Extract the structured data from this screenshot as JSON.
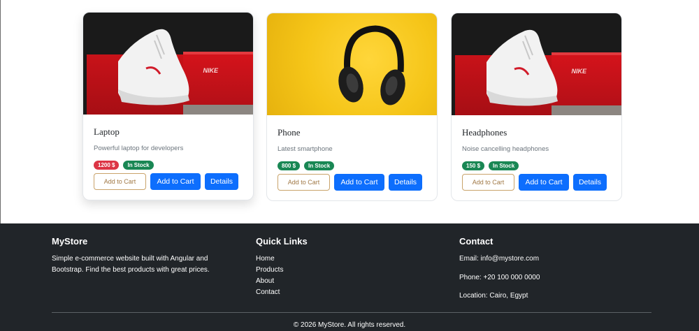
{
  "products": [
    {
      "title": "Laptop",
      "description": "Powerful laptop for developers",
      "price": "1200 $",
      "stock": "In Stock",
      "image_icon": "sneaker-image",
      "add_label": "Add to Cart",
      "cart_label": "Add to Cart",
      "details_label": "Details"
    },
    {
      "title": "Phone",
      "description": "Latest smartphone",
      "price": "800 $",
      "stock": "In Stock",
      "image_icon": "headphones-image",
      "add_label": "Add to Cart",
      "cart_label": "Add to Cart",
      "details_label": "Details"
    },
    {
      "title": "Headphones",
      "description": "Noise cancelling headphones",
      "price": "150 $",
      "stock": "In Stock",
      "image_icon": "sneaker-image",
      "add_label": "Add to Cart",
      "cart_label": "Add to Cart",
      "details_label": "Details"
    }
  ],
  "shoe_box_logo": "NIKE",
  "footer": {
    "brand": {
      "title": "MyStore",
      "description": "Simple e-commerce website built with Angular and Bootstrap. Find the best products with great prices."
    },
    "links": {
      "title": "Quick Links",
      "items": [
        "Home",
        "Products",
        "About",
        "Contact"
      ]
    },
    "contact": {
      "title": "Contact",
      "email": "Email: info@mystore.com",
      "phone": "Phone: +20 100 000 0000",
      "location": "Location: Cairo, Egypt"
    },
    "copyright": "© 2026 MyStore. All rights reserved."
  },
  "colors": {
    "primary": "#0d6efd",
    "danger": "#dc3545",
    "success": "#198754",
    "footer_bg": "#212529"
  }
}
